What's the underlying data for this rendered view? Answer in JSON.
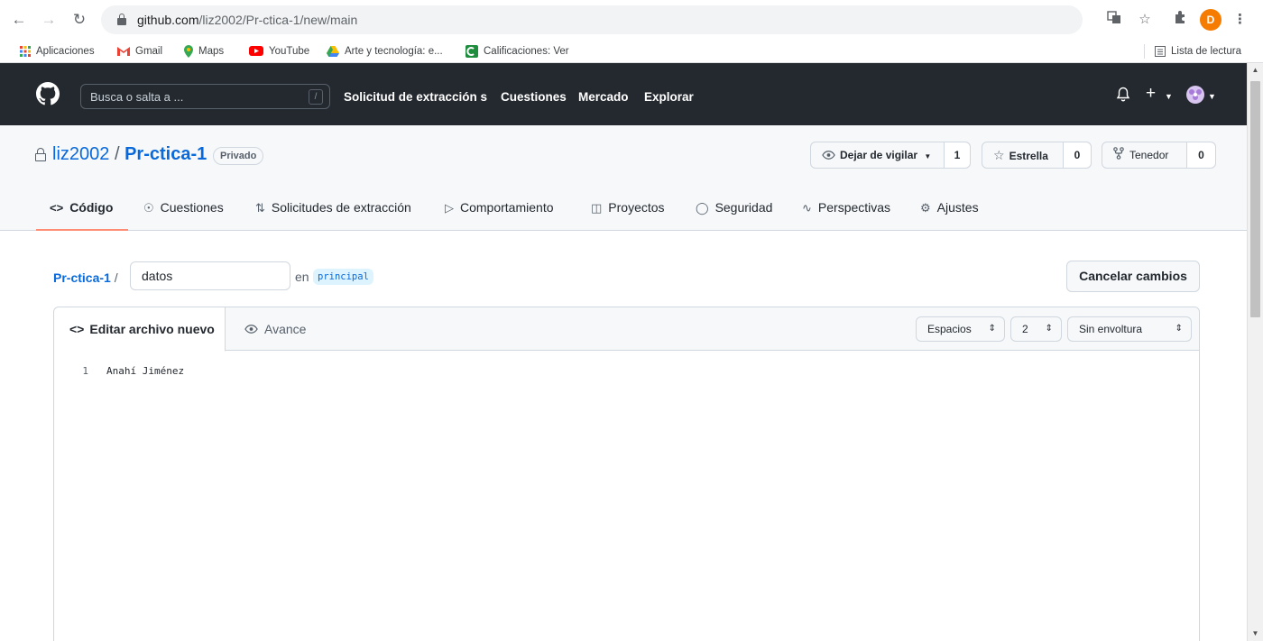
{
  "browser": {
    "url_host": "github.com",
    "url_path": "/liz2002/Pr-ctica-1/new/main",
    "profile_initial": "D",
    "bookmarks": [
      {
        "label": "Aplicaciones"
      },
      {
        "label": "Gmail"
      },
      {
        "label": "Maps"
      },
      {
        "label": "YouTube"
      },
      {
        "label": "Arte y tecnología: e..."
      },
      {
        "label": "Calificaciones: Ver"
      }
    ],
    "reading_list": "Lista de lectura"
  },
  "header": {
    "search_placeholder": "Busca o salta a ...",
    "search_key": "/",
    "nav": [
      "Solicitud de extracción s",
      "Cuestiones",
      "Mercado",
      "Explorar"
    ]
  },
  "repo": {
    "owner": "liz2002",
    "separator": "/",
    "name": "Pr-ctica-1",
    "visibility": "Privado",
    "watch_label": "Dejar de vigilar",
    "watch_count": "1",
    "star_label": "Estrella",
    "star_count": "0",
    "fork_label": "Tenedor",
    "fork_count": "0",
    "tabs": [
      {
        "label": "Código",
        "icon": "code-icon"
      },
      {
        "label": "Cuestiones",
        "icon": "issue-icon"
      },
      {
        "label": "Solicitudes de extracción",
        "icon": "pull-request-icon"
      },
      {
        "label": "Comportamiento",
        "icon": "play-icon"
      },
      {
        "label": "Proyectos",
        "icon": "project-icon"
      },
      {
        "label": "Seguridad",
        "icon": "shield-icon"
      },
      {
        "label": "Perspectivas",
        "icon": "graph-icon"
      },
      {
        "label": "Ajustes",
        "icon": "gear-icon"
      }
    ]
  },
  "editor": {
    "crumb_repo": "Pr-ctica-1",
    "crumb_sep": "/",
    "filename_value": "datos",
    "in_label": "en",
    "branch": "principal",
    "cancel_label": "Cancelar cambios",
    "tab_edit": "Editar archivo nuevo",
    "tab_preview": "Avance",
    "indent_mode": "Espacios",
    "indent_size": "2",
    "wrap_mode": "Sin envoltura",
    "lines": [
      {
        "number": "1",
        "text": "Anahí Jiménez"
      }
    ]
  },
  "colors": {
    "header_bg": "#24292f",
    "link": "#0969da",
    "active_tab_underline": "#fd8c73",
    "profile": "#f57c00"
  }
}
